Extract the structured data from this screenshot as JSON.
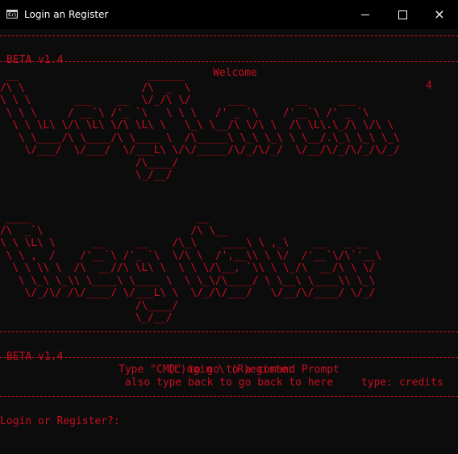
{
  "window": {
    "title": "Login an Register",
    "icon": "console-icon",
    "controls": {
      "minimize": "minimize",
      "maximize": "maximize",
      "close": "×"
    }
  },
  "header": {
    "version": "BETA v1.4",
    "welcome": "Welcome",
    "count": "4"
  },
  "banner1": " __                     ______\n/\\ \\                   /\\  _  \\\n\\ \\ \\       ___    __  \\/_/\\ \\/      ___        __     ___\n \\ \\ \\     / __`\\ /'_ `\\   \\ \\ \\   /' _ `\\    /'__`\\ /' _ `\\\n  \\ \\ \\L\\ \\/\\ \\L\\ \\/\\ \\L\\ \\   \\_\\ \\__/\\ \\/\\ \\  /\\ \\L\\.\\_/\\ \\/\\ \\\n   \\ \\____/\\ \\____/\\ \\____ \\  /\\_____\\ \\_\\ \\_\\ \\ \\__/.\\_\\ \\_\\ \\_\\\n    \\/___/  \\/___/  \\/___L\\ \\/\\/_____/\\/_/\\/_/  \\/__/\\/_/\\/_/\\/_/\n                      /\\____/\n                      \\_/__/",
  "banner2": " ____                           __\n/\\  _`\\                        /\\ \\__\n\\ \\ \\L\\ \\      __     __    /\\_\\    ____\\ \\ ,_\\    __   _ __\n \\ \\ ,  /    /'__`\\ /'_ `\\  \\/\\ \\  /',__\\\\ \\ \\/  /'__`\\/\\`'__\\\n  \\ \\ \\\\ \\  /\\  __//\\ \\L\\ \\  \\ \\ \\/\\__, `\\\\ \\ \\_/\\  __/\\ \\ \\/\n   \\ \\_\\ \\_\\\\ \\____\\ \\____ \\  \\ \\_\\/\\____/ \\ \\__\\ \\____\\\\ \\_\\\n    \\/_/\\/ /\\/____/ \\/___L\\ \\  \\/_/\\/___/   \\/__/\\/____/ \\/_/\n                      /\\____/\n                      \\_/__/",
  "footer": {
    "version": "BETA v1.4",
    "options": "(L)ogin \\ (R)egister",
    "credits": "type: credits"
  },
  "info": {
    "line1": "Type \"CMD\" to go to a comand Prompt",
    "line2": "also type back to go back to here"
  },
  "prompt": {
    "text": "Login or Register?:",
    "value": ""
  }
}
